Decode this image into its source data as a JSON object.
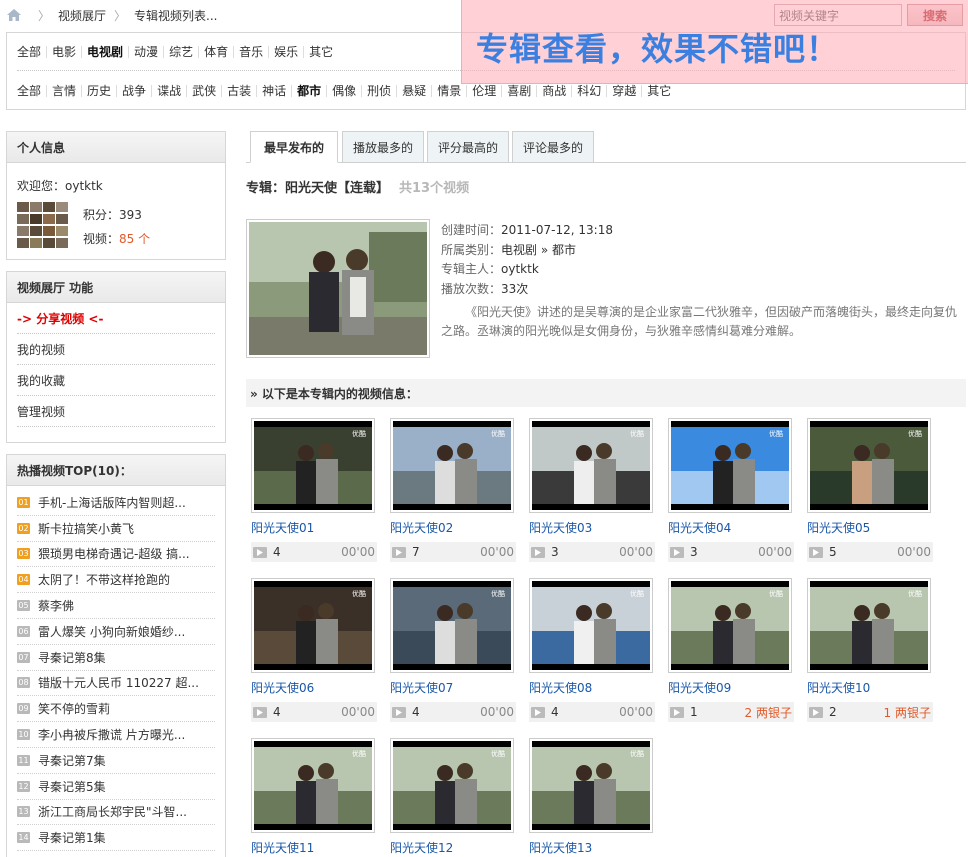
{
  "breadcrumb": {
    "home_icon": "home-icon",
    "items": [
      "视频展厅",
      "专辑视频列表..."
    ]
  },
  "search": {
    "placeholder": "视频关键字",
    "button_label": "搜索"
  },
  "promo": {
    "text": "专辑查看，效果不错吧！",
    "background": "#ffaab4",
    "text_color": "#3b80e0"
  },
  "categories": {
    "main": [
      "全部",
      "电影",
      "电视剧",
      "动漫",
      "综艺",
      "体育",
      "音乐",
      "娱乐",
      "其它"
    ],
    "main_active": "电视剧",
    "sub": [
      "全部",
      "言情",
      "历史",
      "战争",
      "谍战",
      "武侠",
      "古装",
      "神话",
      "都市",
      "偶像",
      "刑侦",
      "悬疑",
      "情景",
      "伦理",
      "喜剧",
      "商战",
      "科幻",
      "穿越",
      "其它"
    ],
    "sub_active": "都市"
  },
  "user_panel": {
    "title": "个人信息",
    "welcome": "欢迎您：oytktk",
    "points_label": "积分：",
    "points": "393",
    "videos_label": "视频：",
    "videos_count": "85 个"
  },
  "function_panel": {
    "title": "视频展厅 功能",
    "items": [
      "-> 分享视频 <-",
      "我的视频",
      "我的收藏",
      "管理视频"
    ]
  },
  "top_panel": {
    "title": "热播视频TOP(10)：",
    "items": [
      {
        "rank": "01",
        "title": "手机-上海话版阵内智则超...",
        "hot": true
      },
      {
        "rank": "02",
        "title": "斯卡拉搞笑小黄飞",
        "hot": true
      },
      {
        "rank": "03",
        "title": "猥琐男电梯奇遇记-超级 搞...",
        "hot": true
      },
      {
        "rank": "04",
        "title": "太阴了！不带这样抢跑的",
        "hot": true
      },
      {
        "rank": "05",
        "title": "蔡李佛",
        "hot": false
      },
      {
        "rank": "06",
        "title": "雷人爆笑 小狗向新娘婚纱...",
        "hot": false
      },
      {
        "rank": "07",
        "title": "寻秦记第8集",
        "hot": false
      },
      {
        "rank": "08",
        "title": "错版十元人民币 110227 超...",
        "hot": false
      },
      {
        "rank": "09",
        "title": "笑不停的雪莉",
        "hot": false
      },
      {
        "rank": "10",
        "title": "李小冉被斥撒谎 片方曝光...",
        "hot": false
      },
      {
        "rank": "11",
        "title": "寻秦记第7集",
        "hot": false
      },
      {
        "rank": "12",
        "title": "寻秦记第5集",
        "hot": false
      },
      {
        "rank": "13",
        "title": "浙江工商局长郑宇民\"斗智...",
        "hot": false
      },
      {
        "rank": "14",
        "title": "寻秦记第1集",
        "hot": false
      }
    ]
  },
  "tabs": [
    "最早发布的",
    "播放最多的",
    "评分最高的",
    "评论最多的"
  ],
  "album": {
    "label": "专辑：阳光天使【连载】",
    "total": "共13个视频",
    "created_label": "创建时间：",
    "created": "2011-07-12, 13:18",
    "category_label": "所属类别：",
    "category": "电视剧 » 都市",
    "owner_label": "专辑主人：",
    "owner": "oytktk",
    "plays_label": "播放次数：",
    "plays": "33次",
    "description": "《阳光天使》讲述的是吴尊演的是企业家富二代狄雅辛，但因破产而落魄街头，最终走向复仇之路。丞琳演的阳光晚似是女佣身份，与狄雅辛感情纠葛难分难解。"
  },
  "section_title": "» 以下是本专辑内的视频信息：",
  "videos": [
    {
      "name": "阳光天使01",
      "plays": "4",
      "extra": "00'00",
      "coins": false
    },
    {
      "name": "阳光天使02",
      "plays": "7",
      "extra": "00'00",
      "coins": false
    },
    {
      "name": "阳光天使03",
      "plays": "3",
      "extra": "00'00",
      "coins": false
    },
    {
      "name": "阳光天使04",
      "plays": "3",
      "extra": "00'00",
      "coins": false
    },
    {
      "name": "阳光天使05",
      "plays": "5",
      "extra": "00'00",
      "coins": false
    },
    {
      "name": "阳光天使06",
      "plays": "4",
      "extra": "00'00",
      "coins": false
    },
    {
      "name": "阳光天使07",
      "plays": "4",
      "extra": "00'00",
      "coins": false
    },
    {
      "name": "阳光天使08",
      "plays": "4",
      "extra": "00'00",
      "coins": false
    },
    {
      "name": "阳光天使09",
      "plays": "1",
      "extra": "2 两银子",
      "coins": true
    },
    {
      "name": "阳光天使10",
      "plays": "2",
      "extra": "1 两银子",
      "coins": true
    },
    {
      "name": "阳光天使11",
      "plays": "",
      "extra": "",
      "coins": false
    },
    {
      "name": "阳光天使12",
      "plays": "",
      "extra": "",
      "coins": false
    },
    {
      "name": "阳光天使13",
      "plays": "",
      "extra": "",
      "coins": false
    }
  ],
  "thumb_watermark": "优酷"
}
